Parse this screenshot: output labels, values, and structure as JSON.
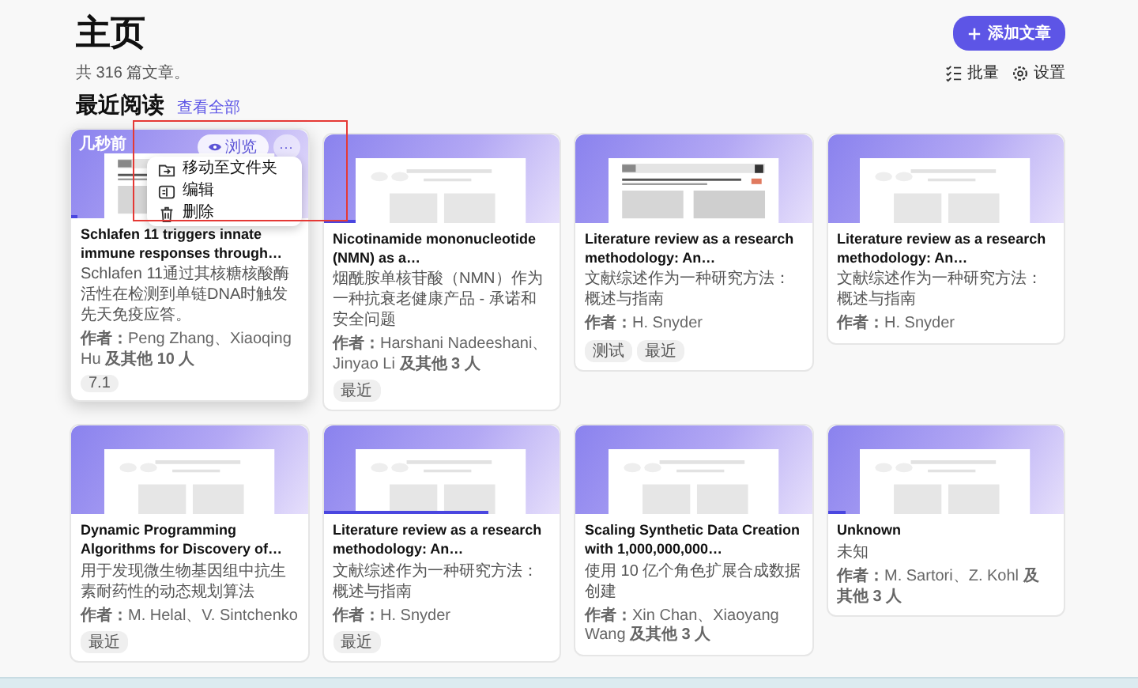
{
  "header": {
    "title": "主页",
    "add_button": "添加文章",
    "count": "共 316 篇文章。",
    "batch_button": "批量",
    "settings_button": "设置"
  },
  "section": {
    "title": "最近阅读",
    "link": "查看全部"
  },
  "cards": [
    {
      "title": "Schlafen 11 triggers innate immune responses through…",
      "summary": "Schlafen 11通过其核糖核酸酶活性在检测到单链DNA时触发先天免疫应答。",
      "authors": "**作者：**Peng Zhang、Xiaoqing Hu **及其他 10 人**",
      "tags": [
        "7.1"
      ],
      "kind": "document",
      "level": 0.03,
      "hovered": true,
      "overlay": {
        "time": "几秒前",
        "view_button": "浏览",
        "more_button": "···",
        "menu": [
          {
            "kind": "move",
            "label": "移动至文件夹"
          },
          {
            "kind": "edit",
            "label": "编辑"
          },
          {
            "kind": "delete",
            "label": "删除"
          }
        ]
      }
    },
    {
      "title": "Nicotinamide mononucleotide (NMN) as a…",
      "summary": "烟酰胺单核苷酸（NMN）作为一种抗衰老健康产品 - 承诺和安全问题",
      "authors": "**作者：**Harshani Nadeeshani、Jinyao Li **及其他 3 人**",
      "tags": [
        "最近"
      ],
      "kind": "placeholder",
      "level": 0.14,
      "hovered": false
    },
    {
      "title": "Literature review as a research methodology: An…",
      "summary": "文献综述作为一种研究方法：概述与指南",
      "authors": "**作者：**H. Snyder",
      "tags": [
        "测试",
        "最近"
      ],
      "kind": "document",
      "hovered": false
    },
    {
      "title": "Literature review as a research methodology: An…",
      "summary": "文献综述作为一种研究方法：概述与指南",
      "authors": "**作者：**H. Snyder",
      "kind": "placeholder",
      "hovered": false
    },
    {
      "title": "Dynamic Programming Algorithms for Discovery of…",
      "summary": "用于发现微生物基因组中抗生素耐药性的动态规划算法",
      "authors": "**作者：**M. Helal、V. Sintchenko",
      "tags": [
        "最近"
      ],
      "kind": "placeholder",
      "hovered": false
    },
    {
      "title": "Literature review as a research methodology: An…",
      "summary": "文献综述作为一种研究方法：概述与指南",
      "authors": "**作者：**H. Snyder",
      "tags": [
        "最近"
      ],
      "kind": "placeholder",
      "level": 0.7,
      "hovered": false
    },
    {
      "title": "Scaling Synthetic Data Creation with 1,000,000,000…",
      "summary": "使用 10 亿个角色扩展合成数据创建",
      "authors": "**作者：**Xin Chan、Xiaoyang Wang **及其他 3 人**",
      "kind": "placeholder",
      "hovered": false
    },
    {
      "title": "Unknown",
      "summary": "未知",
      "authors": "**作者：**M. Sartori、Z. Kohl **及其他 3 人**",
      "kind": "placeholder",
      "level": 0.08,
      "hovered": false
    }
  ]
}
